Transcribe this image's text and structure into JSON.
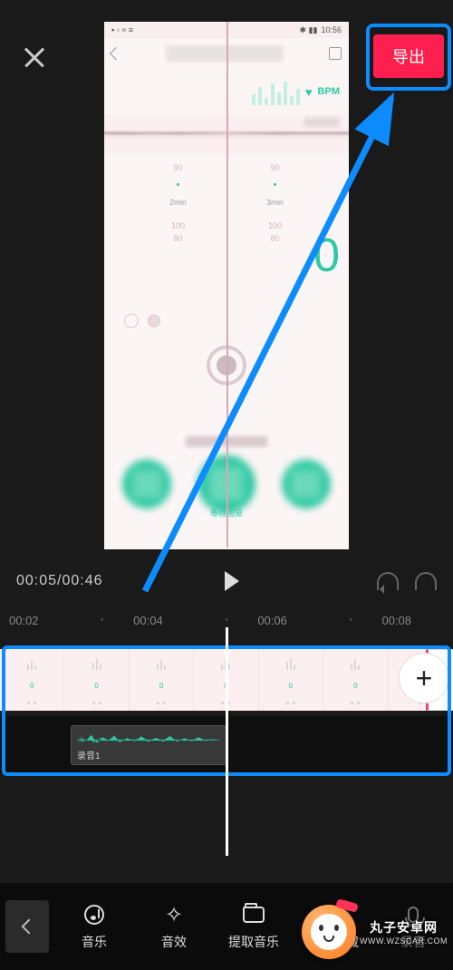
{
  "header": {
    "export_label": "导出"
  },
  "preview": {
    "status_time": "10:56",
    "bpm_label": "BPM",
    "ticks_top": [
      "90",
      "90"
    ],
    "time_labels": [
      "2min",
      "3min"
    ],
    "ticks_bot": [
      "100",
      "80",
      "100",
      "80"
    ],
    "big_value": "0",
    "caption": "等待回览"
  },
  "controls": {
    "current": "00:05",
    "total": "00:46"
  },
  "timeline": {
    "markers": [
      "00:02",
      "00:04",
      "00:06",
      "00:08"
    ],
    "frame_value": "0",
    "audio_clip_label": "录音1"
  },
  "toolbar": {
    "items": [
      {
        "label": "音乐"
      },
      {
        "label": "音效"
      },
      {
        "label": "提取音乐"
      },
      {
        "label": "抖音收藏"
      },
      {
        "label": "录音"
      }
    ]
  },
  "watermark": {
    "cn": "丸子安卓网",
    "en": "WWW.WZSCAR.COM"
  }
}
